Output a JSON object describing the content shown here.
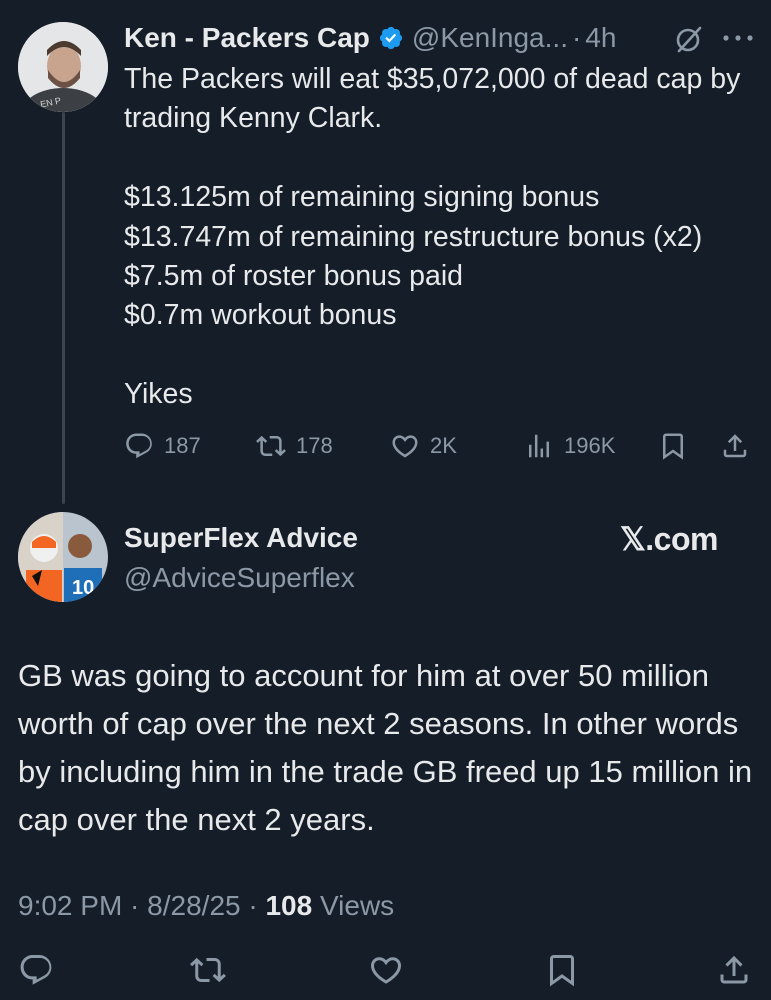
{
  "main_post": {
    "author_name": "Ken - Packers Cap",
    "handle": "@KenInga...",
    "time_sep": "·",
    "time": "4h",
    "text": "The Packers will eat $35,072,000 of dead cap by trading Kenny Clark.\n\n$13.125m of remaining signing bonus\n$13.747m of remaining restructure bonus (x2)\n$7.5m of roster bonus paid\n$0.7m workout bonus\n\nYikes",
    "stats": {
      "replies": "187",
      "reposts": "178",
      "likes": "2K",
      "views": "196K"
    },
    "avatar_text": "EN P"
  },
  "reply_post": {
    "author_name": "SuperFlex Advice",
    "handle": "@AdviceSuperflex",
    "source_badge": "𝕏.com",
    "avatar_jersey": "10",
    "text": "GB was going to account for him at over 50 million worth of cap over the next 2 seasons. In other words by including him in the trade GB freed up 15 million in cap over the next 2 years.",
    "meta": {
      "time": "9:02 PM",
      "sep1": " · ",
      "date": "8/28/25",
      "sep2": " · ",
      "views_count": "108",
      "views_label": " Views"
    }
  },
  "colors": {
    "background": "#151d28",
    "text_primary": "#e7e9ea",
    "text_secondary": "#8b98a5",
    "verified_blue": "#1d9bf0"
  },
  "icons": [
    "verified-badge-icon",
    "grok-icon",
    "more-icon",
    "reply-icon",
    "repost-icon",
    "like-icon",
    "views-icon",
    "bookmark-icon",
    "share-icon"
  ]
}
